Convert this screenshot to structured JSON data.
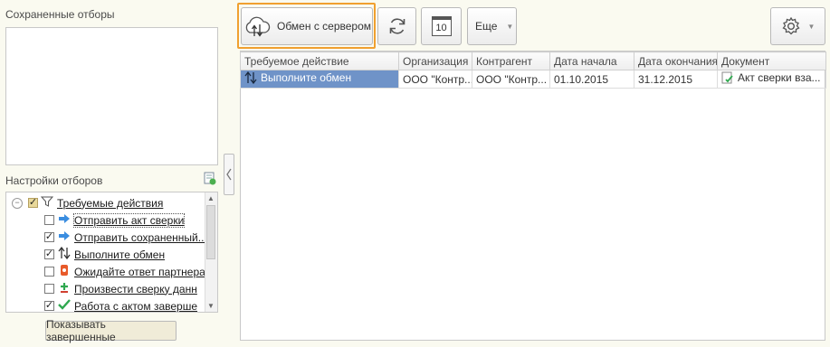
{
  "saved_filters": {
    "title": "Сохраненные отборы"
  },
  "filter_settings": {
    "title": "Настройки отборов",
    "root": {
      "label": "Требуемые действия",
      "checked": true
    },
    "items": [
      {
        "label": "Отправить акт сверки",
        "checked": false,
        "icon": "arrow-right-icon"
      },
      {
        "label": "Отправить сохраненный...",
        "checked": true,
        "icon": "arrow-right-icon"
      },
      {
        "label": "Выполните обмен",
        "checked": true,
        "icon": "exchange-arrows-icon"
      },
      {
        "label": "Ожидайте ответ партнера",
        "checked": false,
        "icon": "hourglass-icon"
      },
      {
        "label": "Произвести сверку данн",
        "checked": false,
        "icon": "add-plus-icon"
      },
      {
        "label": "Работа с актом заверше",
        "checked": true,
        "icon": "checkmark-icon"
      }
    ]
  },
  "show_completed_button": "Показывать завершенные",
  "toolbar": {
    "exchange_button": "Обмен с сервером",
    "more_button": "Еще",
    "calendar_day": "10"
  },
  "table": {
    "columns": [
      "Требуемое действие",
      "Организация",
      "Контрагент",
      "Дата начала",
      "Дата окончания",
      "Документ"
    ],
    "rows": [
      {
        "action": "Выполните обмен",
        "org": "ООО \"Контр...",
        "counterparty": "ООО \"Контр...",
        "start": "01.10.2015",
        "end": "31.12.2015",
        "document": "Акт сверки вза..."
      }
    ]
  },
  "colors": {
    "accent_border": "#f0a030",
    "selection": "#6f93c8",
    "background": "#fafaf0"
  }
}
